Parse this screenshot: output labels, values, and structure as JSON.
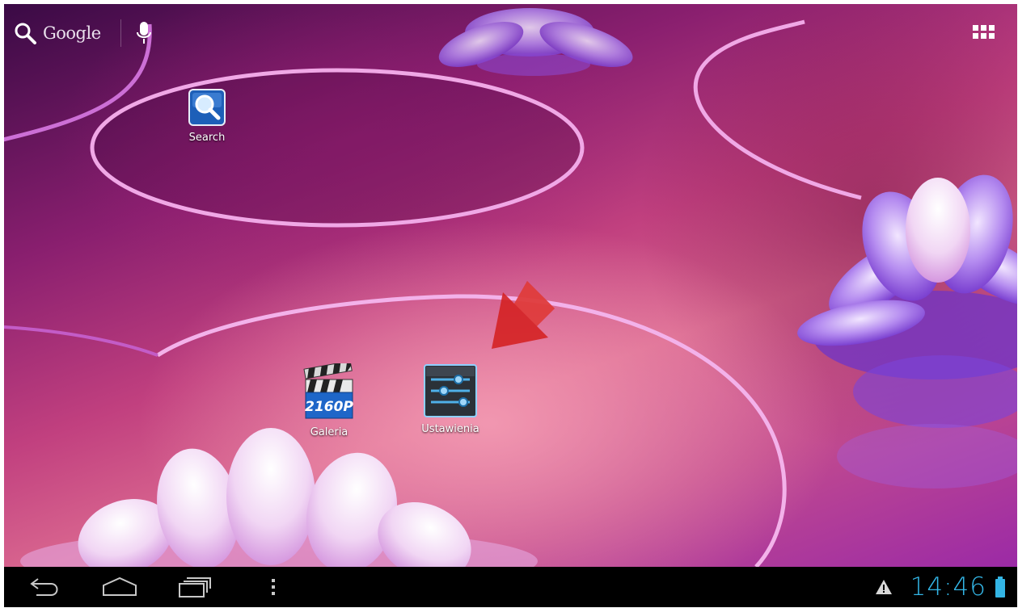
{
  "search_bar": {
    "label": "Google",
    "search_icon": "magnifier-icon",
    "mic_icon": "microphone-icon"
  },
  "apps_button": {
    "icon": "apps-grid-icon"
  },
  "desktop_icons": [
    {
      "label": "Search",
      "icon": "search-app-icon"
    },
    {
      "label": "Galeria",
      "icon": "clapperboard-2160p-icon",
      "badge": "2160P"
    },
    {
      "label": "Ustawienia",
      "icon": "settings-sliders-icon"
    }
  ],
  "annotation": {
    "icon": "red-arrow-icon",
    "color": "#d42020"
  },
  "nav_bar": {
    "back_icon": "back-icon",
    "home_icon": "home-icon",
    "recent_icon": "recent-apps-icon",
    "menu_icon": "overflow-menu-icon"
  },
  "status": {
    "warning_icon": "warning-icon",
    "clock": "14:46",
    "battery_icon": "battery-icon",
    "accent_color": "#33b5e5"
  }
}
